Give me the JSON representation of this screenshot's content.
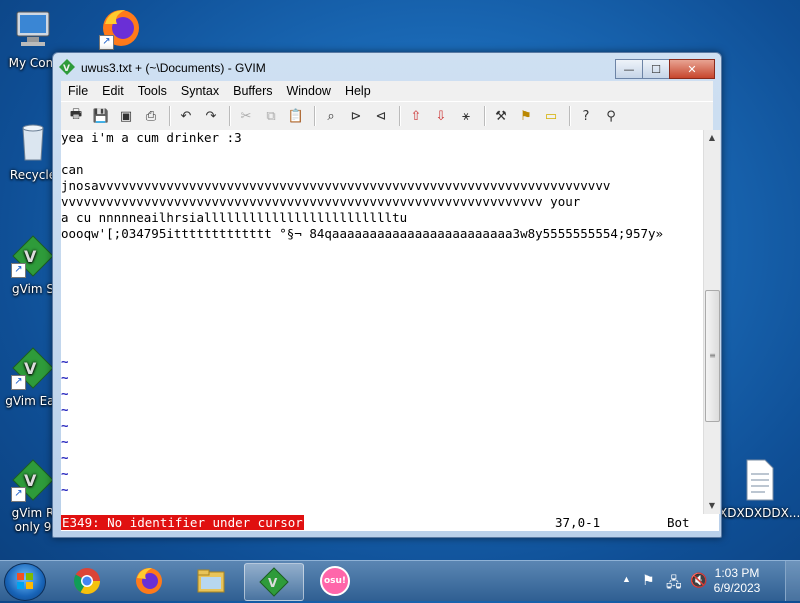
{
  "desktop": {
    "icons": [
      {
        "label": "My Com"
      },
      {
        "label": ""
      },
      {
        "label": "Recycle"
      },
      {
        "label": "gVim S"
      },
      {
        "label": "gVim Eas"
      },
      {
        "label": "gVim R\nonly 9"
      },
      {
        "label": "XDXDXDDX..."
      }
    ]
  },
  "window": {
    "title": "uwus3.txt + (~\\Documents) - GVIM",
    "menu": [
      "File",
      "Edit",
      "Tools",
      "Syntax",
      "Buffers",
      "Window",
      "Help"
    ],
    "buttons": {
      "minimize": "—",
      "maximize": "☐",
      "close": "✕"
    },
    "editor_lines": [
      "yea i'm a cum drinker :3",
      "",
      "can",
      "jnosavvvvvvvvvvvvvvvvvvvvvvvvvvvvvvvvvvvvvvvvvvvvvvvvvvvvvvvvvvvvvvvvvvvv",
      "vvvvvvvvvvvvvvvvvvvvvvvvvvvvvvvvvvvvvvvvvvvvvvvvvvvvvvvvvvvvvvvv your",
      "a cu nnnnneailhrsiallllllllllllllllllllllllltu",
      "oooqw'[;034795ittttttttttttt °§¬ 84qaaaaaaaaaaaaaaaaaaaaaaaa3w8y5555555554;957y»"
    ],
    "tilde_count": 9,
    "status": {
      "error": "E349: No identifier under cursor",
      "position": "37,0-1",
      "scroll": "Bot"
    }
  },
  "taskbar": {
    "clock_time": "1:03 PM",
    "clock_date": "6/9/2023",
    "osu_label": "osu!"
  },
  "colors": {
    "error_bg": "#e01010",
    "tilde": "#2a2abf",
    "taskbar": "#2f5f92"
  }
}
